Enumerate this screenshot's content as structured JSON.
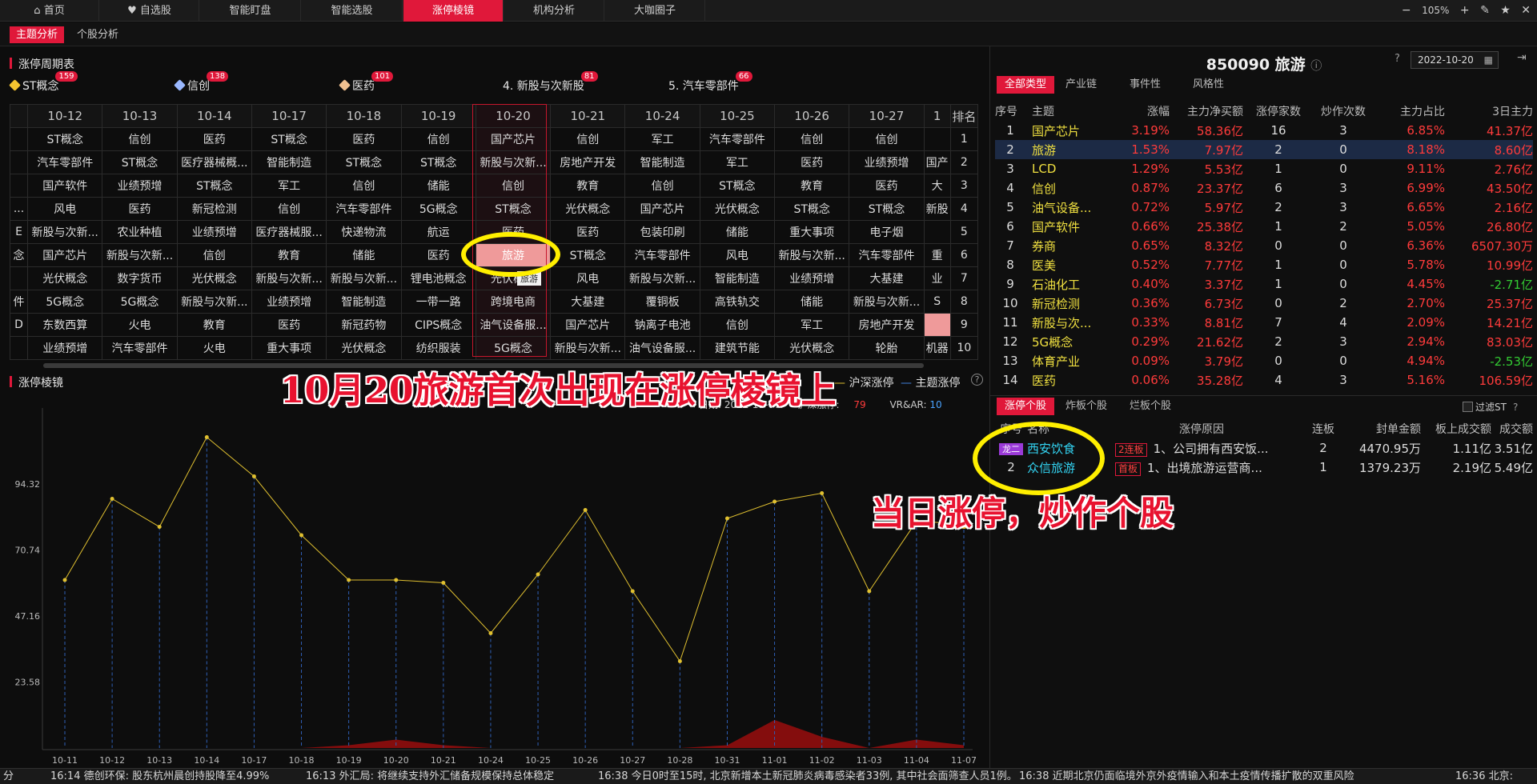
{
  "nav": {
    "tabs": [
      "首页",
      "自选股",
      "智能盯盘",
      "智能选股",
      "涨停棱镜",
      "机构分析",
      "大咖圈子"
    ],
    "active_index": 4,
    "zoom": "105%"
  },
  "subnav": {
    "tabs": [
      "主题分析",
      "个股分析"
    ],
    "active_index": 0
  },
  "period": {
    "title": "涨停周期表",
    "hot_concepts": [
      {
        "label": "ST概念",
        "count": "159",
        "icon_color": "#f4c430"
      },
      {
        "label": "信创",
        "count": "138",
        "icon_color": "#9ab8ff"
      },
      {
        "label": "医药",
        "count": "101",
        "icon_color": "#f0c090"
      },
      {
        "label": "4. 新股与次新股",
        "count": "81"
      },
      {
        "label": "5. 汽车零部件",
        "count": "66"
      }
    ],
    "dates": [
      "10-12",
      "10-13",
      "10-14",
      "10-17",
      "10-18",
      "10-19",
      "10-20",
      "10-21",
      "10-24",
      "10-25",
      "10-26",
      "10-27",
      "1"
    ],
    "rank_label": "排名",
    "rows": [
      {
        "lead": "",
        "cells": [
          "ST概念",
          "信创",
          "医药",
          "ST概念",
          "医药",
          "信创",
          "国产芯片",
          "信创",
          "军工",
          "汽车零部件",
          "信创",
          "信创",
          ""
        ],
        "rank": "1"
      },
      {
        "lead": "",
        "cells": [
          "汽车零部件",
          "ST概念",
          "医疗器械概...",
          "智能制造",
          "ST概念",
          "ST概念",
          "新股与次新...",
          "房地产开发",
          "智能制造",
          "军工",
          "医药",
          "业绩预增",
          "国产"
        ],
        "rank": "2"
      },
      {
        "lead": "",
        "cells": [
          "国产软件",
          "业绩预增",
          "ST概念",
          "军工",
          "信创",
          "储能",
          "信创",
          "教育",
          "信创",
          "ST概念",
          "教育",
          "医药",
          "大"
        ],
        "rank": "3"
      },
      {
        "lead": "...",
        "cells": [
          "风电",
          "医药",
          "新冠检测",
          "信创",
          "汽车零部件",
          "5G概念",
          "ST概念",
          "光伏概念",
          "国产芯片",
          "光伏概念",
          "ST概念",
          "ST概念",
          "新股"
        ],
        "rank": "4"
      },
      {
        "lead": "E",
        "cells": [
          "新股与次新...",
          "农业种植",
          "业绩预增",
          "医疗器械服...",
          "快递物流",
          "航运",
          "医药",
          "医药",
          "包装印刷",
          "储能",
          "重大事项",
          "电子烟",
          ""
        ],
        "rank": "5"
      },
      {
        "lead": "念",
        "cells": [
          "国产芯片",
          "新股与次新...",
          "信创",
          "教育",
          "储能",
          "医药",
          "旅游",
          "ST概念",
          "汽车零部件",
          "风电",
          "新股与次新...",
          "汽车零部件",
          "重"
        ],
        "rank": "6"
      },
      {
        "lead": "",
        "cells": [
          "光伏概念",
          "数字货币",
          "光伏概念",
          "新股与次新...",
          "新股与次新...",
          "锂电池概念",
          "光伏概念",
          "风电",
          "新股与次新...",
          "智能制造",
          "业绩预增",
          "大基建",
          "业"
        ],
        "rank": "7"
      },
      {
        "lead": "件",
        "cells": [
          "5G概念",
          "5G概念",
          "新股与次新...",
          "业绩预增",
          "智能制造",
          "一带一路",
          "跨境电商",
          "大基建",
          "覆铜板",
          "高铁轨交",
          "储能",
          "新股与次新...",
          "S"
        ],
        "rank": "8"
      },
      {
        "lead": "D",
        "cells": [
          "东数西算",
          "火电",
          "教育",
          "医药",
          "新冠药物",
          "CIPS概念",
          "油气设备服...",
          "国产芯片",
          "钠离子电池",
          "信创",
          "军工",
          "房地产开发",
          ""
        ],
        "rank": "9"
      },
      {
        "lead": "",
        "cells": [
          "业绩预增",
          "汽车零部件",
          "火电",
          "重大事项",
          "光伏概念",
          "纺织服装",
          "5G概念",
          "新股与次新...",
          "油气设备服...",
          "建筑节能",
          "光伏概念",
          "轮胎",
          "机器"
        ],
        "rank": "10"
      }
    ],
    "tooltip": "旅游"
  },
  "annotations": {
    "title_note": "10月20旅游首次出现在涨停棱镜上",
    "stock_note": "当日涨停，炒作个股"
  },
  "prism": {
    "title": "涨停棱镜",
    "legend_index": "沪深涨停",
    "legend_theme": "主题涨停",
    "info_date_label": "日期:",
    "info_date": "2022-11-07",
    "info_limitup_label": "沪深涨停:",
    "info_limitup": "79",
    "info_vrar_label": "VR&AR:",
    "info_vrar": "10"
  },
  "chart_data": {
    "type": "line",
    "x": [
      "10-11",
      "10-12",
      "10-13",
      "10-14",
      "10-17",
      "10-18",
      "10-19",
      "10-20",
      "10-21",
      "10-24",
      "10-25",
      "10-26",
      "10-27",
      "10-28",
      "10-31",
      "11-01",
      "11-02",
      "11-03",
      "11-04",
      "11-07"
    ],
    "series": [
      {
        "name": "沪深涨停",
        "values": [
          60,
          89,
          79,
          111,
          97,
          76,
          60,
          60,
          59,
          41,
          62,
          85,
          56,
          31,
          82,
          88,
          91,
          56,
          81,
          80
        ],
        "color": "#e0c030"
      },
      {
        "name": "主题涨停",
        "values": [
          0,
          0,
          0,
          0,
          0,
          0,
          1,
          3,
          1,
          0,
          0,
          0,
          0,
          0,
          1,
          10,
          4,
          0,
          3,
          1
        ],
        "color": "#8b0e0e"
      }
    ],
    "yticks": [
      23.58,
      47.16,
      70.74,
      94.32
    ],
    "ylim": [
      0,
      120
    ]
  },
  "right": {
    "code_title": "850090 旅游",
    "date": "2022-10-20",
    "type_tabs": [
      "全部类型",
      "产业链",
      "事件性",
      "风格性"
    ],
    "theme_headers": [
      "序号",
      "主题",
      "涨幅",
      "主力净买额",
      "涨停家数",
      "炒作次数",
      "主力占比",
      "3日主力"
    ],
    "themes": [
      [
        "1",
        "国产芯片",
        "3.19%",
        "58.36亿",
        "16",
        "3",
        "6.85%",
        "41.37亿"
      ],
      [
        "2",
        "旅游",
        "1.53%",
        "7.97亿",
        "2",
        "0",
        "8.18%",
        "8.60亿"
      ],
      [
        "3",
        "LCD",
        "1.29%",
        "5.53亿",
        "1",
        "0",
        "9.11%",
        "2.76亿"
      ],
      [
        "4",
        "信创",
        "0.87%",
        "23.37亿",
        "6",
        "3",
        "6.99%",
        "43.50亿"
      ],
      [
        "5",
        "油气设备...",
        "0.72%",
        "5.97亿",
        "2",
        "3",
        "6.65%",
        "2.16亿"
      ],
      [
        "6",
        "国产软件",
        "0.66%",
        "25.38亿",
        "1",
        "2",
        "5.05%",
        "26.80亿"
      ],
      [
        "7",
        "券商",
        "0.65%",
        "8.32亿",
        "0",
        "0",
        "6.36%",
        "6507.30万"
      ],
      [
        "8",
        "医美",
        "0.52%",
        "7.77亿",
        "1",
        "0",
        "5.78%",
        "10.99亿"
      ],
      [
        "9",
        "石油化工",
        "0.40%",
        "3.37亿",
        "1",
        "0",
        "4.45%",
        "-2.71亿"
      ],
      [
        "10",
        "新冠检测",
        "0.36%",
        "6.73亿",
        "0",
        "2",
        "2.70%",
        "25.37亿"
      ],
      [
        "11",
        "新股与次...",
        "0.33%",
        "8.81亿",
        "7",
        "4",
        "2.09%",
        "14.21亿"
      ],
      [
        "12",
        "5G概念",
        "0.29%",
        "21.62亿",
        "2",
        "3",
        "2.94%",
        "83.03亿"
      ],
      [
        "13",
        "体育产业",
        "0.09%",
        "3.79亿",
        "0",
        "0",
        "4.94%",
        "-2.53亿"
      ],
      [
        "14",
        "医药",
        "0.06%",
        "35.28亿",
        "4",
        "3",
        "5.16%",
        "106.59亿"
      ]
    ],
    "selected_row": 1,
    "stock_tabs": [
      "涨停个股",
      "炸板个股",
      "烂板个股"
    ],
    "filter_st": "过滤ST",
    "stock_headers": [
      "序号",
      "名称",
      "涨停原因",
      "连板",
      "封单金额",
      "板上成交额",
      "成交额"
    ],
    "stocks": [
      {
        "tag": "龙二",
        "name": "西安饮食",
        "badge": "2连板",
        "reason": "1、公司拥有西安饭...",
        "streak": "2",
        "seal": "4470.95万",
        "onboard": "1.11亿",
        "turnover": "3.51亿"
      },
      {
        "tag": "2",
        "name": "众信旅游",
        "badge": "首板",
        "reason": "1、出境旅游运营商...",
        "streak": "1",
        "seal": "1379.23万",
        "onboard": "2.19亿",
        "turnover": "5.49亿"
      }
    ]
  },
  "ticker": [
    "分",
    "16:14 德创环保: 股东杭州晨创持股降至4.99%",
    "16:13 外汇局: 将继续支持外汇储备规模保持总体稳定",
    "16:38 今日0时至15时, 北京新增本土新冠肺炎病毒感染者33例, 其中社会面筛查人员1例。",
    "16:38 近期北京仍面临境外京外疫情输入和本土疫情传播扩散的双重风险",
    "16:36 北京:"
  ]
}
